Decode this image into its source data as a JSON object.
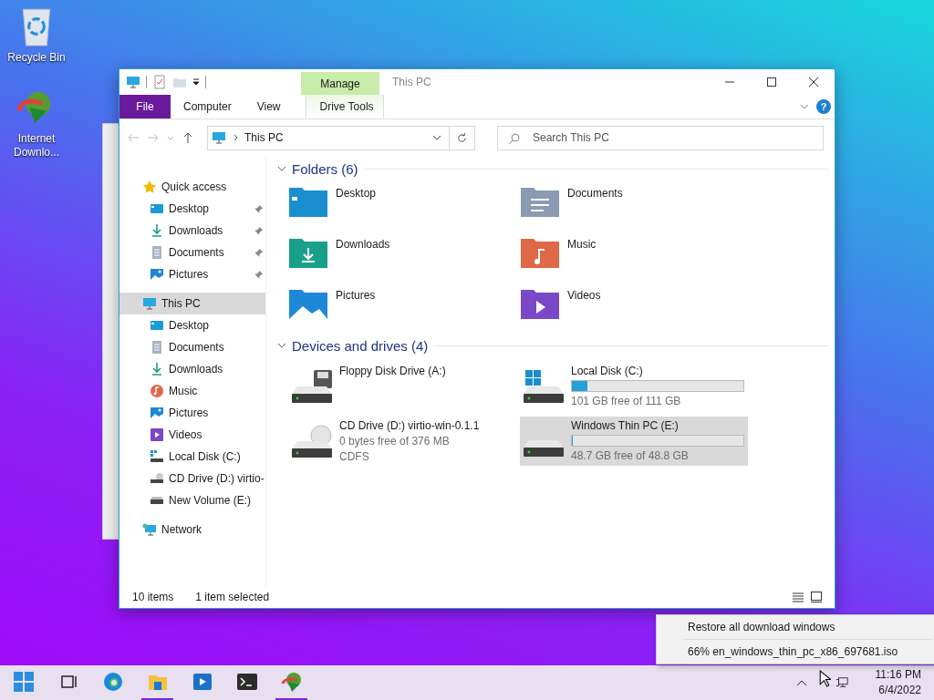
{
  "desktop_icons": [
    {
      "kind": "recycle",
      "label": "Recycle Bin"
    },
    {
      "kind": "idm",
      "label": "Internet Downlo..."
    }
  ],
  "explorer": {
    "title": "This PC",
    "contextual_tab": "Manage",
    "help": "?",
    "ribbon_tabs": [
      {
        "kind": "file",
        "label": "File",
        "selected": false
      },
      {
        "kind": "tab",
        "label": "Computer",
        "selected": false
      },
      {
        "kind": "tab",
        "label": "View",
        "selected": false
      },
      {
        "kind": "context",
        "label": "Drive Tools",
        "selected": false
      }
    ],
    "address": "This PC",
    "search": {
      "placeholder": "Search This PC"
    },
    "nav": [
      {
        "label": "Quick access",
        "kind": "star",
        "selected": false,
        "children": [
          {
            "label": "Desktop",
            "kind": "desktop",
            "pinned": true,
            "selected": false
          },
          {
            "label": "Downloads",
            "kind": "downloads",
            "pinned": true,
            "selected": false
          },
          {
            "label": "Documents",
            "kind": "documents",
            "pinned": true,
            "selected": false
          },
          {
            "label": "Pictures",
            "kind": "pictures",
            "pinned": true,
            "selected": false
          }
        ]
      },
      {
        "label": "This PC",
        "kind": "thispc",
        "selected": true,
        "children": [
          {
            "label": "Desktop",
            "kind": "desktop",
            "selected": false
          },
          {
            "label": "Documents",
            "kind": "documents",
            "selected": false
          },
          {
            "label": "Downloads",
            "kind": "downloads",
            "selected": false
          },
          {
            "label": "Music",
            "kind": "music",
            "selected": false
          },
          {
            "label": "Pictures",
            "kind": "pictures",
            "selected": false
          },
          {
            "label": "Videos",
            "kind": "videos",
            "selected": false
          },
          {
            "label": "Local Disk (C:)",
            "kind": "localdisk",
            "selected": false
          },
          {
            "label": "CD Drive (D:) virtio-",
            "kind": "cddrive",
            "selected": false
          },
          {
            "label": "New Volume (E:)",
            "kind": "volume",
            "selected": false
          }
        ]
      },
      {
        "label": "Network",
        "kind": "network",
        "selected": false
      }
    ],
    "folders": {
      "title": "Folders (6)",
      "expanded": true,
      "items": [
        {
          "label": "Desktop",
          "kind": "desktop"
        },
        {
          "label": "Documents",
          "kind": "documents"
        },
        {
          "label": "Downloads",
          "kind": "downloads"
        },
        {
          "label": "Music",
          "kind": "music"
        },
        {
          "label": "Pictures",
          "kind": "pictures"
        },
        {
          "label": "Videos",
          "kind": "videos"
        }
      ]
    },
    "drives": {
      "title": "Devices and drives (4)",
      "expanded": true,
      "items": [
        {
          "kind": "floppy",
          "name": "Floppy Disk Drive (A:)",
          "selected": false
        },
        {
          "kind": "system",
          "name": "Local Disk (C:)",
          "level": 0.09,
          "free": "101 GB free of 111 GB",
          "selected": false
        },
        {
          "kind": "cd",
          "name": "CD Drive (D:) virtio-win-0.1.1",
          "free": "0 bytes free of 376 MB",
          "fs": "CDFS",
          "selected": false
        },
        {
          "kind": "disk",
          "name": "Windows Thin PC (E:)",
          "level": 0.003,
          "free": "48.7 GB free of 48.8 GB",
          "selected": true
        }
      ]
    },
    "status": {
      "count": "10 items",
      "selection": "1 item selected"
    }
  },
  "popup_menu": [
    {
      "label": "Restore all download windows"
    },
    {
      "label": "66% en_windows_thin_pc_x86_697681.iso"
    }
  ],
  "taskbar": {
    "apps": [
      {
        "kind": "start",
        "running": false
      },
      {
        "kind": "taskview",
        "running": false
      },
      {
        "kind": "edge",
        "running": false
      },
      {
        "kind": "explorer",
        "running": true
      },
      {
        "kind": "media",
        "running": false
      },
      {
        "kind": "terminal",
        "running": false
      },
      {
        "kind": "idm",
        "running": true
      }
    ],
    "time": "11:16 PM",
    "date": "6/4/2022"
  }
}
